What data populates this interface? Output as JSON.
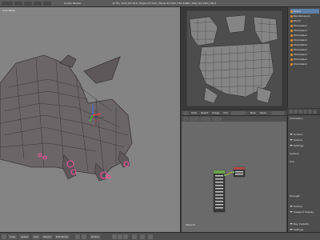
{
  "app": {
    "info_bar": {
      "engine": "Cycles Render",
      "stats": "v2.79 | Verts 0/3,514 | Edges 0/7,022 | Faces 0/3,504 | Tris 6,984 | Mem 95.15M | Obj 1"
    }
  },
  "viewport": {
    "title": "User Persp",
    "colors": {
      "background": "#848484",
      "mesh": "#6b6568",
      "wire": "#3b3638",
      "selected": "#ff4fa0"
    }
  },
  "uv_editor": {
    "header": {
      "view": "View",
      "select": "Select",
      "image": "Image",
      "uvs": "UVs",
      "new": "New",
      "open": "Open"
    }
  },
  "node_editor": {
    "label": "Material"
  },
  "outliner": {
    "items": [
      {
        "label": "Scene"
      },
      {
        "label": "RenderLayers"
      },
      {
        "label": "World"
      },
      {
        "label": "Chameleon"
      },
      {
        "label": "Chameleon"
      },
      {
        "label": "Chameleon"
      },
      {
        "label": "Chameleon"
      },
      {
        "label": "Chameleon"
      },
      {
        "label": "Chameleon"
      },
      {
        "label": "Chameleon"
      },
      {
        "label": "Chameleon"
      },
      {
        "label": "Chameleon"
      }
    ]
  },
  "properties": {
    "rows": [
      "Chameleon",
      "Surface",
      "Volume",
      "Settings",
      "Surface",
      "Use",
      "Viewport Display",
      "Custom Properties"
    ],
    "lower_rows": [
      "Strength",
      "Volume",
      "Viewport Display",
      "Ray Visibility",
      "Settings"
    ]
  },
  "bottom_bar": {
    "view": "View",
    "select": "Select",
    "add": "Add",
    "object": "Object",
    "mode": "Edit Mode",
    "global": "Global"
  }
}
